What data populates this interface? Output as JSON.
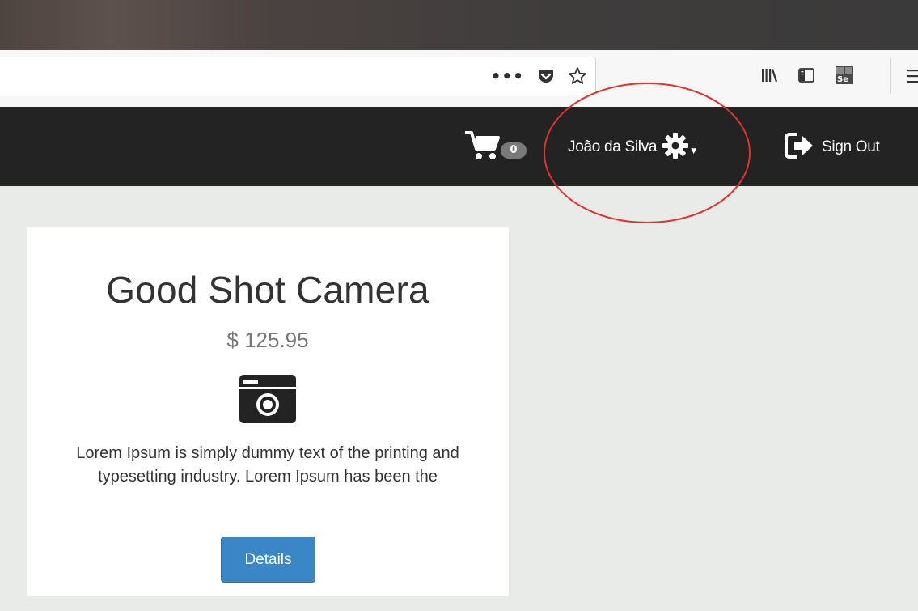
{
  "browser": {
    "toolbar": {
      "more_glyph": "•••",
      "icons": [
        "more-actions-icon",
        "pocket-icon",
        "bookmark-star-icon",
        "library-icon",
        "sidebar-icon",
        "selenium-icon",
        "menu-icon"
      ]
    }
  },
  "navbar": {
    "cart_count": "0",
    "user_name": "João da Silva",
    "signout_label": "Sign Out"
  },
  "product": {
    "title": "Good Shot Camera",
    "price": "$ 125.95",
    "description": "Lorem Ipsum is simply dummy text of the printing and typesetting industry. Lorem Ipsum has been the",
    "details_label": "Details",
    "icon": "camera-icon"
  },
  "colors": {
    "navbar": "#232323",
    "page_background": "#e9ebe8",
    "button": "#3b86c6",
    "highlight": "#e2322d"
  }
}
